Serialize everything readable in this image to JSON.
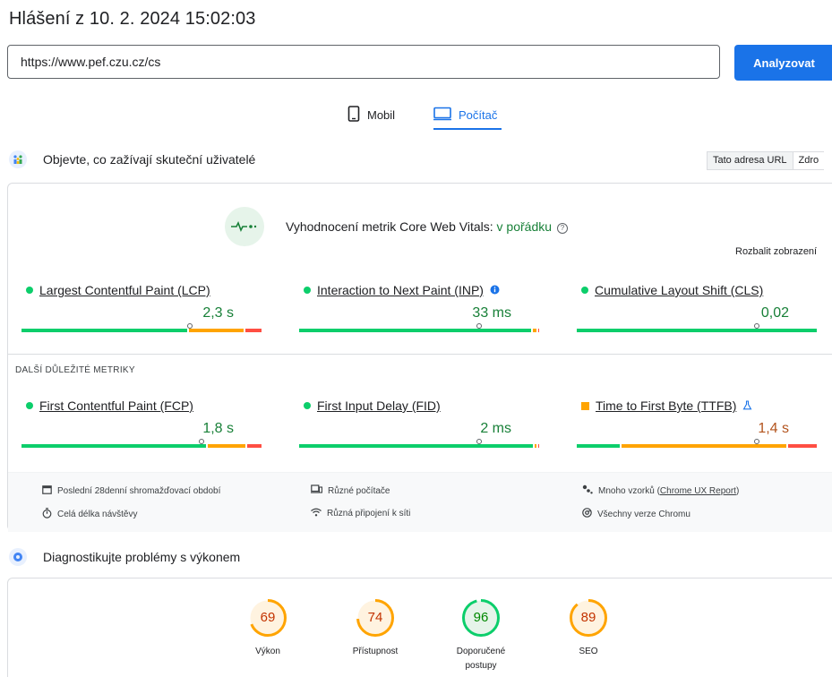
{
  "report": {
    "title": "Hlášení z 10. 2. 2024 15:02:03"
  },
  "search": {
    "url_value": "https://www.pef.czu.cz/cs",
    "analyze_label": "Analyzovat"
  },
  "tabs": [
    {
      "label": "Mobil",
      "icon": "phone-icon",
      "selected": false
    },
    {
      "label": "Počítač",
      "icon": "desktop-icon",
      "selected": true
    }
  ],
  "field_data": {
    "heading": "Objevte, co zažívají skuteční uživatelé",
    "toggle": {
      "url_label": "Tato adresa URL",
      "origin_label": "Zdro"
    },
    "cwv": {
      "title_prefix": "Vyhodnocení metrik Core Web Vitals:",
      "status": "v pořádku",
      "expand_label": "Rozbalit zobrazení"
    },
    "metrics": [
      {
        "name": "Largest Contentful Paint (LCP)",
        "value": "2,3 s",
        "status": "good",
        "distribution": [
          0.7,
          0.23,
          0.07
        ],
        "marker": 0.7
      },
      {
        "name": "Interaction to Next Paint (INP)",
        "value": "33 ms",
        "status": "good",
        "distribution": [
          0.98,
          0.015,
          0.005
        ],
        "marker": 0.75,
        "info": true
      },
      {
        "name": "Cumulative Layout Shift (CLS)",
        "value": "0,02",
        "status": "good",
        "distribution": [
          1.0,
          0,
          0
        ],
        "marker": 0.75
      }
    ],
    "other_heading": "DALŠÍ DŮLEŽITÉ METRIKY",
    "other_metrics": [
      {
        "name": "First Contentful Paint (FCP)",
        "value": "1,8 s",
        "status": "good",
        "distribution": [
          0.78,
          0.16,
          0.06
        ],
        "marker": 0.75
      },
      {
        "name": "First Input Delay (FID)",
        "value": "2 ms",
        "status": "good",
        "distribution": [
          0.99,
          0.007,
          0.003
        ],
        "marker": 0.75
      },
      {
        "name": "Time to First Byte (TTFB)",
        "value": "1,4 s",
        "status": "average",
        "distribution": [
          0.18,
          0.7,
          0.12
        ],
        "marker": 0.75,
        "experimental": true
      }
    ],
    "footer": {
      "period": "Poslední 28denní shromažďovací období",
      "visit": "Celá délka návštěvy",
      "devices": "Různé počítače",
      "connections": "Různá připojení k síti",
      "samples_prefix": "Mnoho vzorků (",
      "samples_link": "Chrome UX Report",
      "samples_suffix": ")",
      "chrome": "Všechny verze Chromu"
    }
  },
  "lab": {
    "heading": "Diagnostikujte problémy s výkonem",
    "scores": [
      {
        "label": "Výkon",
        "score": "69",
        "value": 0.69,
        "color": "#ffa400",
        "text_color": "#c33300",
        "bg": "#fff3e0"
      },
      {
        "label": "Přístupnost",
        "score": "74",
        "value": 0.74,
        "color": "#ffa400",
        "text_color": "#c33300",
        "bg": "#fff3e0"
      },
      {
        "label": "Doporučené postupy",
        "score": "96",
        "value": 0.96,
        "color": "#0cce6b",
        "text_color": "#008800",
        "bg": "#e6f4ea"
      },
      {
        "label": "SEO",
        "score": "89",
        "value": 0.89,
        "color": "#ffa400",
        "text_color": "#c33300",
        "bg": "#fff3e0"
      }
    ]
  },
  "colors": {
    "accent": "#1a73e8",
    "good": "#0cce6b",
    "average": "#ffa400",
    "poor": "#ff4e42"
  }
}
